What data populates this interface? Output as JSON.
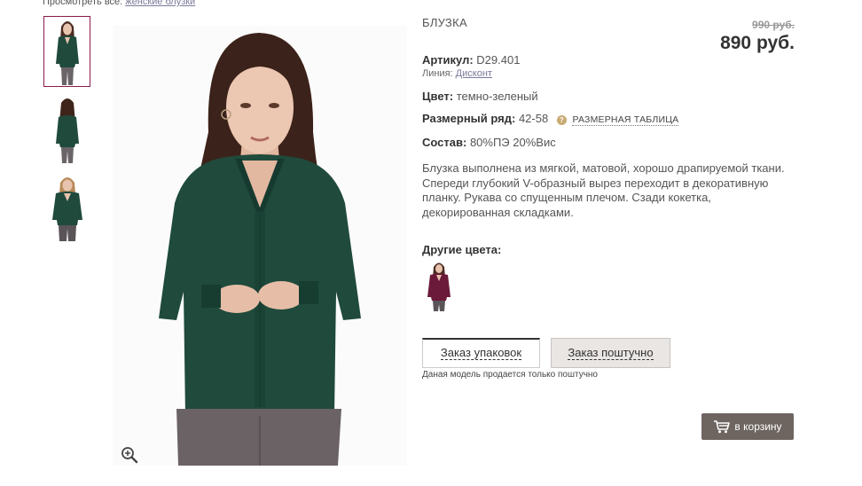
{
  "breadcrumb": {
    "prefix": "Просмотреть все:",
    "link": "женские блузки"
  },
  "product": {
    "category": "БЛУЗКА",
    "old_price": "990 руб.",
    "price": "890 руб.",
    "sku_label": "Артикул:",
    "sku": "D29.401",
    "line_label": "Линия:",
    "line": "Дисконт",
    "color_label": "Цвет:",
    "color": "темно-зеленый",
    "size_label": "Размерный ряд:",
    "size": "42-58",
    "size_table_link": "РАЗМЕРНАЯ ТАБЛИЦА",
    "composition_label": "Состав:",
    "composition": "80%ПЭ 20%Вис",
    "description": "Блузка выполнена из мягкой, матовой, хорошо драпируемой ткани. Спереди глубокий V-образный вырез переходит в декоративную планку. Рукава со спущенным плечом. Сзади кокетка, декорированная складками."
  },
  "other_colors": {
    "title": "Другие цвета:"
  },
  "order": {
    "tab_pack": "Заказ упаковок",
    "tab_piece": "Заказ поштучно",
    "note": "Даная модель продается только поштучно"
  },
  "cart_button": {
    "label": "в корзину"
  },
  "icons": {
    "zoom": "zoom-in-icon",
    "cart": "cart-icon",
    "info": "info-icon"
  },
  "colors": {
    "blouse": "#1f4a3c",
    "alt_blouse": "#6b1a3a",
    "accent_border": "#8a1c4a",
    "cart_bg": "#6e6560",
    "info_dot": "#c8aa72"
  }
}
